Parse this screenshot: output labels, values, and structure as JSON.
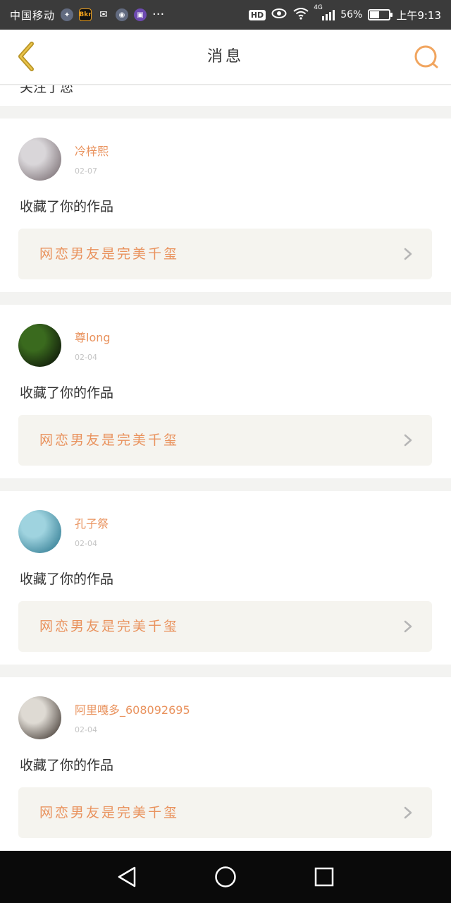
{
  "status_bar": {
    "carrier": "中国移动",
    "app_icon_b_label": "Bkr",
    "more_dots": "···",
    "hd_label": "HD",
    "network_label": "4G",
    "battery_percent": "56%",
    "battery_level": 0.56,
    "time": "上午9:13"
  },
  "header": {
    "title": "消息"
  },
  "partial_card": {
    "text": "关注了您"
  },
  "notifications": [
    {
      "username": "冷梓熙",
      "date": "02-07",
      "action": "收藏了你的作品",
      "work_title": "网恋男友是完美千玺",
      "avatar_colors": [
        "#d9d6d9",
        "#6b5e63"
      ]
    },
    {
      "username": "尊long",
      "date": "02-04",
      "action": "收藏了你的作品",
      "work_title": "网恋男友是完美千玺",
      "avatar_colors": [
        "#3a6a1e",
        "#050505"
      ]
    },
    {
      "username": "孔子祭",
      "date": "02-04",
      "action": "收藏了你的作品",
      "work_title": "网恋男友是完美千玺",
      "avatar_colors": [
        "#9fd3df",
        "#1f6d86"
      ]
    },
    {
      "username": "阿里嘎多_608092695",
      "date": "02-04",
      "action": "收藏了你的作品",
      "work_title": "网恋男友是完美千玺",
      "avatar_colors": [
        "#dedad3",
        "#2b211b"
      ]
    }
  ],
  "colors": {
    "accent": "#e9925d",
    "back_arrow": "#b89426",
    "search_icon": "#f1a55f",
    "status_bar_bg": "#3b3b3b",
    "nav_bar_bg": "#0a0a0a",
    "page_bg": "#f3f3f1",
    "work_box_bg": "#f5f4ef"
  },
  "icons": {
    "back": "chevron-left-icon",
    "search": "search-icon",
    "chevron": "chevron-right-icon",
    "nav_back": "triangle-back-icon",
    "nav_home": "circle-home-icon",
    "nav_recent": "square-recent-icon"
  }
}
